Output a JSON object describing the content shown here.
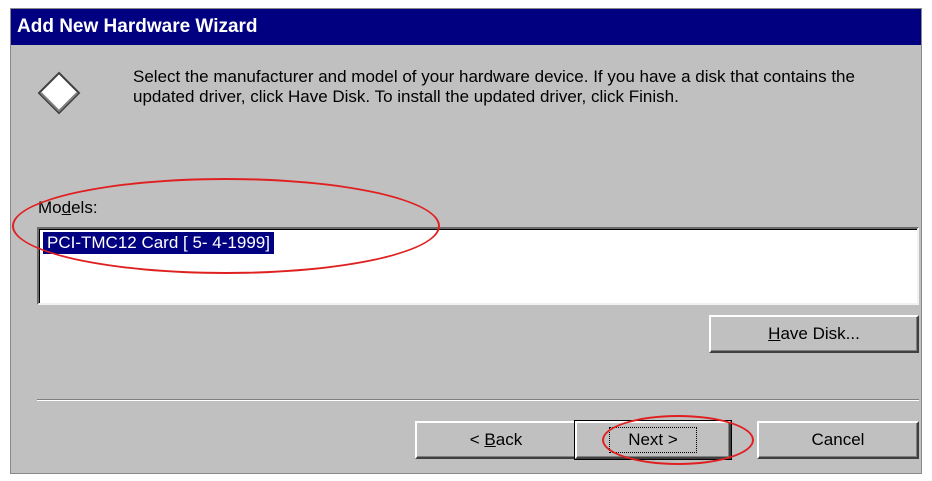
{
  "window": {
    "title": "Add New Hardware Wizard"
  },
  "instructions": "Select the manufacturer and model of your hardware device. If you have a disk that contains the updated driver, click Have Disk. To install the updated driver, click Finish.",
  "models": {
    "label_prefix": "Mo",
    "label_accel": "d",
    "label_suffix": "els:",
    "items": [
      "PCI-TMC12 Card [ 5- 4-1999]"
    ],
    "selected_index": 0
  },
  "buttons": {
    "have_disk_accel": "H",
    "have_disk_rest": "ave Disk...",
    "back_prefix": "< ",
    "back_accel": "B",
    "back_rest": "ack",
    "next": "Next >",
    "cancel": "Cancel"
  },
  "colors": {
    "titlebar": "#000080",
    "dialog_bg": "#c0c0c0",
    "selection": "#000080",
    "annotation": "#e02020"
  },
  "icons": {
    "wizard": "diamond-icon"
  }
}
